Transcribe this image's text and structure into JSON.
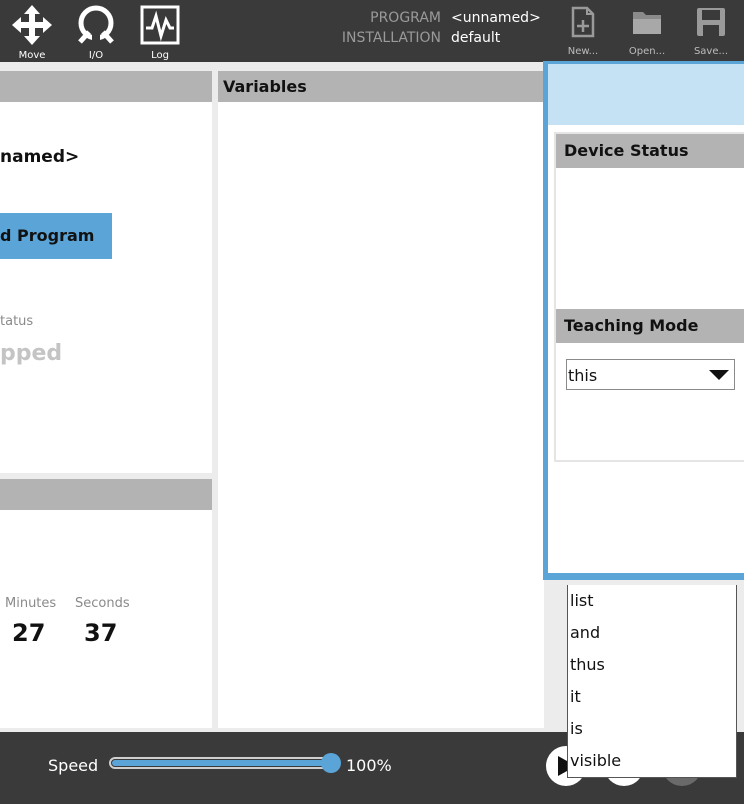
{
  "toolbar": {
    "move_label": "Move",
    "io_label": "I/O",
    "log_label": "Log",
    "program_key": "PROGRAM",
    "program_value": "<unnamed>",
    "installation_key": "INSTALLATION",
    "installation_value": "default",
    "new_label": "New...",
    "open_label": "Open...",
    "save_label": "Save..."
  },
  "left_panel": {
    "program_name": "named>",
    "load_button": "d Program",
    "status_label": "tatus",
    "status_value": "pped",
    "minutes_label": "Minutes",
    "minutes_value": "27",
    "seconds_label": "Seconds",
    "seconds_value": "37"
  },
  "variables": {
    "title": "Variables"
  },
  "right_panel": {
    "device_status_title": "Device Status",
    "teaching_mode_title": "Teaching Mode",
    "teaching_mode_selected": "this"
  },
  "dropdown": {
    "options": [
      "list",
      "and",
      "thus",
      "it",
      "is",
      "visible"
    ]
  },
  "footer": {
    "speed_label": "Speed",
    "speed_value": "100%",
    "speed_fraction": 1.0
  },
  "colors": {
    "accent": "#5aa4d8",
    "topbar": "#3a3a3a",
    "panel_header": "#b3b3b3",
    "light_blue": "#c5e1f4"
  }
}
